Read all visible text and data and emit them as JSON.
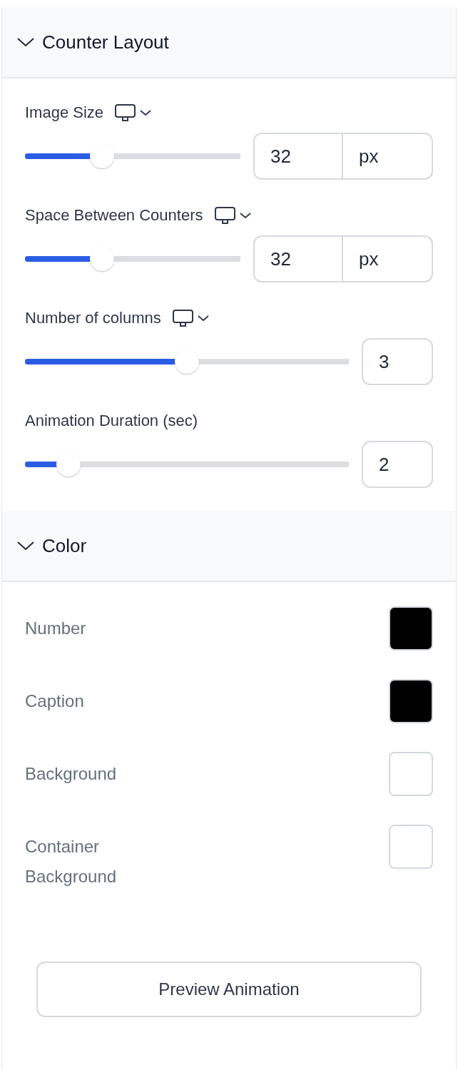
{
  "sections": [
    {
      "kind": "sliders",
      "title": "Counter Layout",
      "expanded": true,
      "fields": [
        {
          "label": "Image Size",
          "responsive": true,
          "level": 0.34,
          "value": "32",
          "unit": "px"
        },
        {
          "label": "Space Between Counters",
          "responsive": true,
          "level": 0.34,
          "value": "32",
          "unit": "px"
        },
        {
          "label": "Number of columns",
          "responsive": true,
          "level": 0.5,
          "value": "3"
        },
        {
          "label": "Animation Duration (sec)",
          "responsive": false,
          "level": 0.105,
          "value": "2"
        }
      ]
    },
    {
      "kind": "colors",
      "title": "Color",
      "expanded": true,
      "fields": [
        {
          "label": "Number",
          "color": "#000000"
        },
        {
          "label": "Caption",
          "color": "#000000"
        },
        {
          "label": "Background",
          "color": "#ffffff"
        },
        {
          "label": "Container Background",
          "color": "#ffffff"
        }
      ]
    }
  ],
  "button": {
    "label": "Preview Animation"
  }
}
